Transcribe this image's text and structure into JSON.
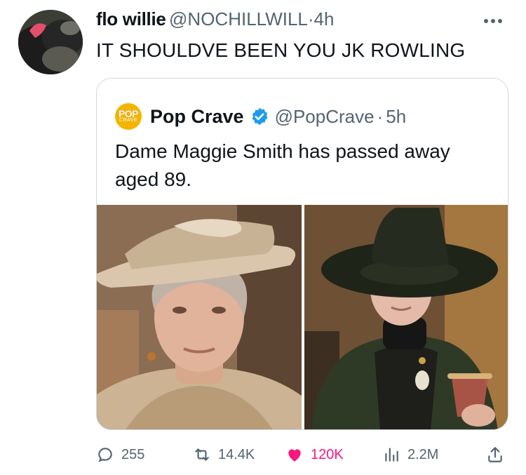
{
  "tweet": {
    "display_name": "flo willie",
    "handle": "@NOCHILLWILL",
    "dot": "·",
    "time": "4h",
    "text": "IT SHOULDVE BEEN YOU JK ROWLING"
  },
  "quote": {
    "logo_line1": "POP",
    "logo_line2": "CRAVE",
    "display_name": "Pop Crave",
    "handle": "@PopCrave",
    "dot": "·",
    "time": "5h",
    "text": "Dame Maggie Smith has passed away aged 89."
  },
  "actions": {
    "replies": "255",
    "reposts": "14.4K",
    "likes": "120K",
    "views": "2.2M"
  },
  "colors": {
    "like": "#f91880",
    "verified": "#1d9bf0",
    "muted": "#536471",
    "logo": "#f5b400"
  }
}
